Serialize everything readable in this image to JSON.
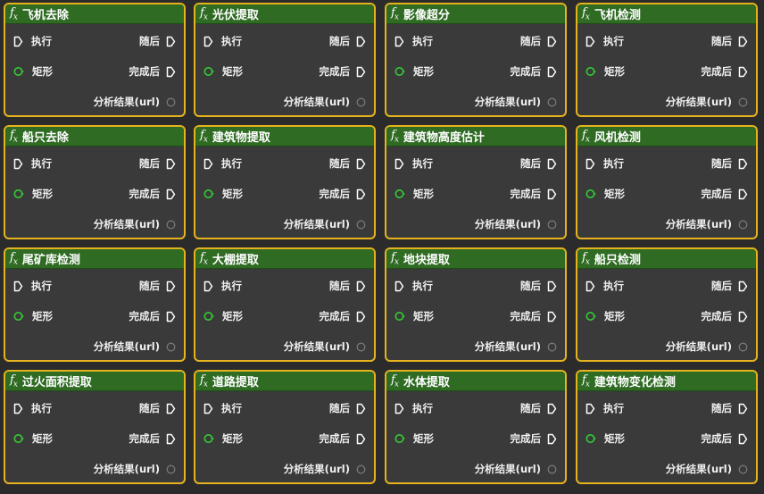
{
  "colors": {
    "background": "#2b2b2b",
    "node_border": "#e6b31e",
    "node_body": "#3a3a3a",
    "header": "#2f6b23",
    "exec_pin": "#ffffff",
    "rect_pin": "#33cc33",
    "url_pin": "#777777"
  },
  "icons": {
    "header": "function-fx-icon",
    "exec": "execution-pin-icon",
    "rect": "data-pin-circle-icon",
    "url": "output-pin-circle-icon"
  },
  "pins": {
    "exec_in": "执行",
    "then_out": "随后",
    "rect_in": "矩形",
    "completed_out": "完成后",
    "result_out": "分析结果(url)"
  },
  "nodes": [
    {
      "title": "飞机去除"
    },
    {
      "title": "光伏提取"
    },
    {
      "title": "影像超分"
    },
    {
      "title": "飞机检测"
    },
    {
      "title": "船只去除"
    },
    {
      "title": "建筑物提取"
    },
    {
      "title": "建筑物高度估计"
    },
    {
      "title": "风机检测"
    },
    {
      "title": "尾矿库检测"
    },
    {
      "title": "大棚提取"
    },
    {
      "title": "地块提取"
    },
    {
      "title": "船只检测"
    },
    {
      "title": "过火面积提取"
    },
    {
      "title": "道路提取"
    },
    {
      "title": "水体提取"
    },
    {
      "title": "建筑物变化检测"
    }
  ]
}
